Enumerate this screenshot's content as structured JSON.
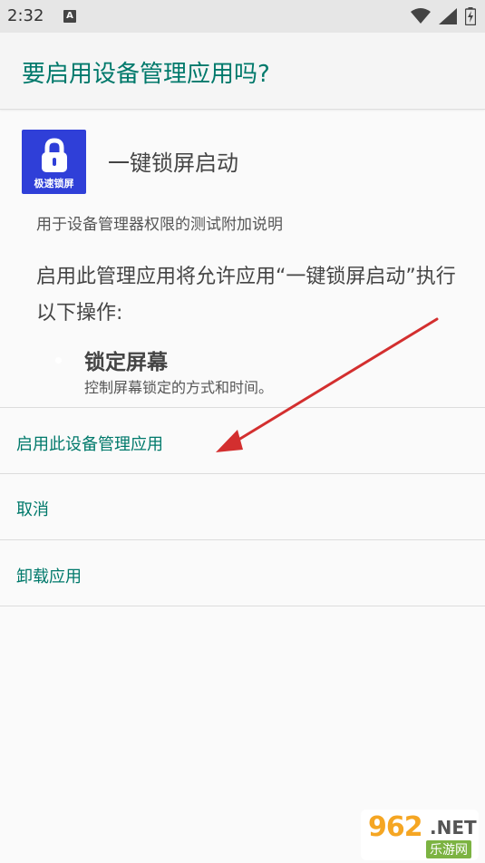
{
  "status_bar": {
    "time": "2:32",
    "notification_icon": "text-a-icon",
    "icons": [
      "wifi-icon",
      "signal-icon",
      "battery-charging-icon"
    ]
  },
  "dialog": {
    "title": "要启用设备管理应用吗?",
    "app": {
      "icon_label": "极速锁屏",
      "name": "一键锁屏启动",
      "description": "用于设备管理器权限的测试附加说明"
    },
    "explanation": "启用此管理应用将允许应用“一键锁屏启动”执行以下操作:",
    "permission": {
      "title": "锁定屏幕",
      "description": "控制屏幕锁定的方式和时间。"
    },
    "actions": {
      "activate": "启用此设备管理应用",
      "cancel": "取消",
      "uninstall": "卸载应用"
    }
  },
  "watermark": {
    "logo": "962",
    "suffix": ".NET",
    "site": "乐游网"
  },
  "colors": {
    "accent": "#00796b",
    "status_bar": "#e6e6e6",
    "app_icon_bg": "#2f3fd8",
    "arrow": "#d32f2f"
  }
}
